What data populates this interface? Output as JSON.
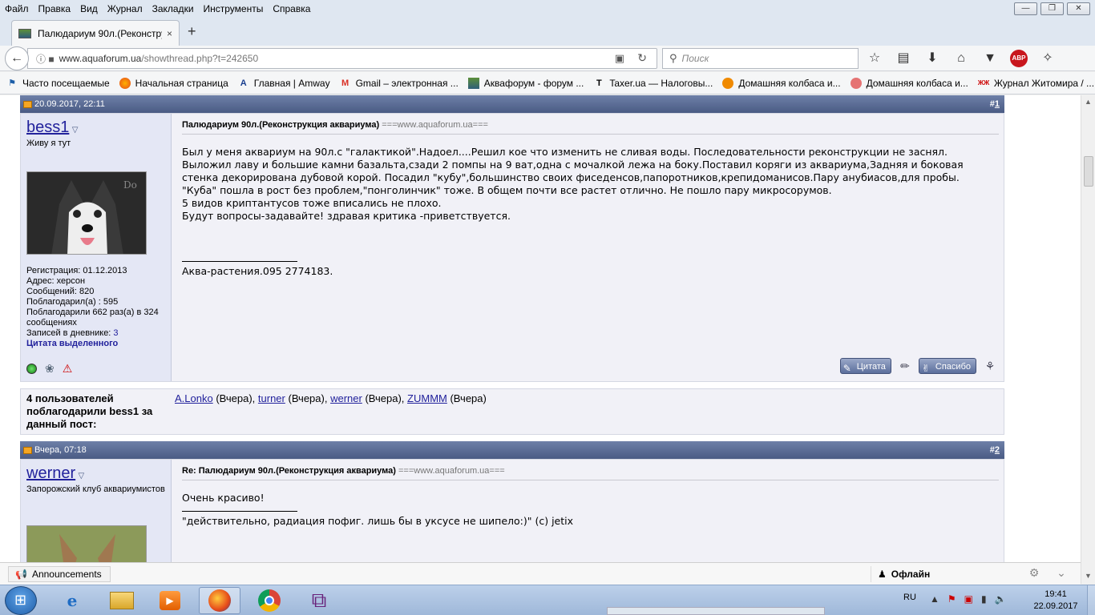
{
  "menubar": {
    "items": [
      "Файл",
      "Правка",
      "Вид",
      "Журнал",
      "Закладки",
      "Инструменты",
      "Справка"
    ]
  },
  "tab": {
    "title": "Палюдариум 90л.(Реконстру",
    "close": "×",
    "new": "+"
  },
  "nav": {
    "url_host": "www.aquaforum.ua",
    "url_path": "/showthread.php?t=242650",
    "search_placeholder": "Поиск"
  },
  "bookmarks": [
    {
      "label": "Часто посещаемые",
      "icon": "bookmark-icon"
    },
    {
      "label": "Начальная страница",
      "icon": "firefox-icon"
    },
    {
      "label": "Главная | Amway",
      "icon": "amway-icon"
    },
    {
      "label": "Gmail – электронная ...",
      "icon": "gmail-icon"
    },
    {
      "label": "Аквафорум - форум ...",
      "icon": "aquaforum-icon"
    },
    {
      "label": "Taxer.ua — Налоговы...",
      "icon": "taxer-icon"
    },
    {
      "label": "Домашняя колбаса и...",
      "icon": "sausage-icon"
    },
    {
      "label": "Домашняя колбаса и...",
      "icon": "sausage2-icon"
    },
    {
      "label": "Журнал Житомира / ...",
      "icon": "zhzh-icon"
    }
  ],
  "posts": [
    {
      "date": "20.09.2017, 22:11",
      "number_prefix": "#",
      "number": "1",
      "user": {
        "name": "bess1",
        "title": "Живу я тут",
        "reg": "Регистрация: 01.12.2013",
        "address": "Адрес: херсон",
        "messages": "Сообщений: 820",
        "thanked": "Поблагодарил(а) : 595",
        "thanked_by": "Поблагодарили 662 раз(а) в 324 сообщениях",
        "diary_label": "Записей в дневнике: ",
        "diary_count": "3",
        "quote_selected": "Цитата выделенного"
      },
      "title": "Палюдариум 90л.(Реконструкция аквариума)",
      "site": "===www.aquaforum.ua===",
      "lines": [
        "Был у меня аквариум на 90л.с \"галактикой\".Надоел....Решил кое что изменить не сливая воды. Последовательности реконструкции не заснял.",
        "Выложил лаву и большие камни базальта,сзади 2 помпы на 9 ват,одна с мочалкой лежа на боку.Поставил коряги из аквариума,Задняя и боковая",
        "стенка декорирована дубовой корой. Посадил \"кубу\",большинство своих фиседенсов,папоротников,крепидоманисов.Пару анубиасов,для пробы.",
        "\"Куба\" пошла в рост без проблем,\"понголинчик\" тоже. В общем почти все растет отлично. Не пошло пару микросорумов.",
        "5 видов криптантусов тоже вписались не плохо.",
        "Будут вопросы-задавайте! здравая критика -приветствуется."
      ],
      "signature": "Аква-растения.095 2774183.",
      "buttons": {
        "quote": "Цитата",
        "thanks": "Спасибо"
      }
    },
    {
      "date": "Вчера, 07:18",
      "number_prefix": "#",
      "number": "2",
      "user": {
        "name": "werner",
        "title": "Запорожский клуб аквариумистов"
      },
      "title": "Re: Палюдариум 90л.(Реконструкция аквариума)",
      "site": "===www.aquaforum.ua===",
      "lines": [
        "Очень красиво!"
      ],
      "signature": "\"действительно, радиация пофиг. лишь бы в уксусе не шипело:)\" (c) jetix"
    }
  ],
  "thanks": {
    "label": "4 пользователей поблагодарили bess1 за данный пост:",
    "users": [
      {
        "name": "A.Lonko",
        "when": " (Вчера), "
      },
      {
        "name": "turner",
        "when": " (Вчера), "
      },
      {
        "name": "werner",
        "when": " (Вчера), "
      },
      {
        "name": "ZUMMM",
        "when": " (Вчера)"
      }
    ]
  },
  "statusbar": {
    "announcements": "Announcements",
    "status": "Офлайн"
  },
  "taskbar": {
    "lang": "RU",
    "time": "19:41",
    "date": "22.09.2017"
  },
  "colors": {
    "post_header": "#4a5b84",
    "user_pane": "#e4e7f5",
    "link": "#22229c"
  }
}
